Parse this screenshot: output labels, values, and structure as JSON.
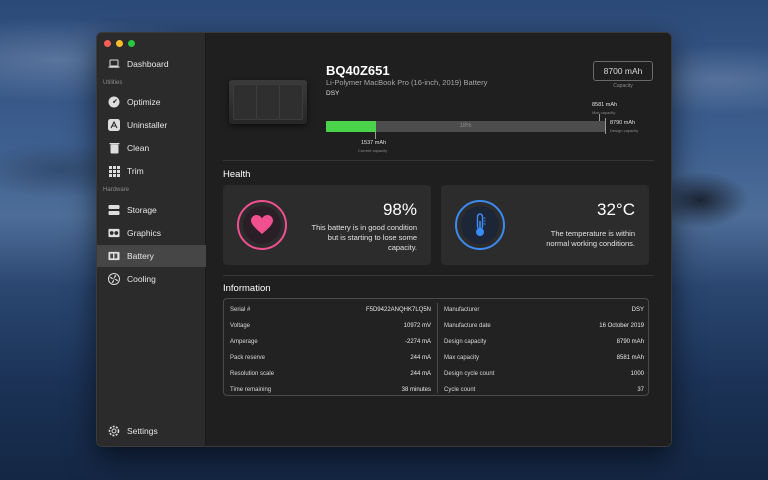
{
  "sidebar": {
    "items": [
      {
        "label": "Dashboard",
        "icon": "laptop-icon"
      },
      {
        "label": "Optimize",
        "icon": "gauge-icon"
      },
      {
        "label": "Uninstaller",
        "icon": "app-store-icon"
      },
      {
        "label": "Clean",
        "icon": "trash-icon"
      },
      {
        "label": "Trim",
        "icon": "grid-icon"
      },
      {
        "label": "Storage",
        "icon": "storage-icon"
      },
      {
        "label": "Graphics",
        "icon": "gpu-icon"
      },
      {
        "label": "Battery",
        "icon": "battery-icon",
        "active": true
      },
      {
        "label": "Cooling",
        "icon": "fan-icon"
      }
    ],
    "section_utilities": "Utilities",
    "section_hardware": "Hardware",
    "settings_label": "Settings"
  },
  "device": {
    "title": "BQ40Z651",
    "subtitle": "Li-Polymer MacBook Pro (16-inch, 2019) Battery",
    "manufacturer": "DSY",
    "capacity_value": "8700 mAh",
    "capacity_caption": "Capacity"
  },
  "charge_bar": {
    "percent_label": "18%",
    "fill_fraction": 0.18,
    "current_value": "1537 mAh",
    "current_caption": "Current capacity",
    "max_value": "8581 mAh",
    "max_caption": "Max capacity",
    "design_value": "8790 mAh",
    "design_caption": "Design capacity"
  },
  "health": {
    "title": "Health",
    "battery_percent": "98%",
    "battery_desc_line1": "This battery is in good condition",
    "battery_desc_line2": "but is starting to lose some",
    "battery_desc_line3": "capacity.",
    "temperature": "32°C",
    "temp_desc_line1": "The temperature is within",
    "temp_desc_line2": "normal working conditions.",
    "colors": {
      "heart": "#f05090",
      "thermo": "#3b8bf5"
    }
  },
  "information": {
    "title": "Information",
    "left": [
      {
        "k": "Serial #",
        "v": "F5D9422ANQHK7LQ5N"
      },
      {
        "k": "Voltage",
        "v": "10972 mV"
      },
      {
        "k": "Amperage",
        "v": "-2274 mA"
      },
      {
        "k": "Pack reserve",
        "v": "244 mA"
      },
      {
        "k": "Resolution scale",
        "v": "244 mA"
      },
      {
        "k": "Time remaining",
        "v": "38 minutes"
      }
    ],
    "right": [
      {
        "k": "Manufacturer",
        "v": "DSY"
      },
      {
        "k": "Manufacture date",
        "v": "16 October 2019"
      },
      {
        "k": "Design capacity",
        "v": "8790 mAh"
      },
      {
        "k": "Max capacity",
        "v": "8581 mAh"
      },
      {
        "k": "Design cycle count",
        "v": "1000"
      },
      {
        "k": "Cycle count",
        "v": "37"
      }
    ]
  }
}
